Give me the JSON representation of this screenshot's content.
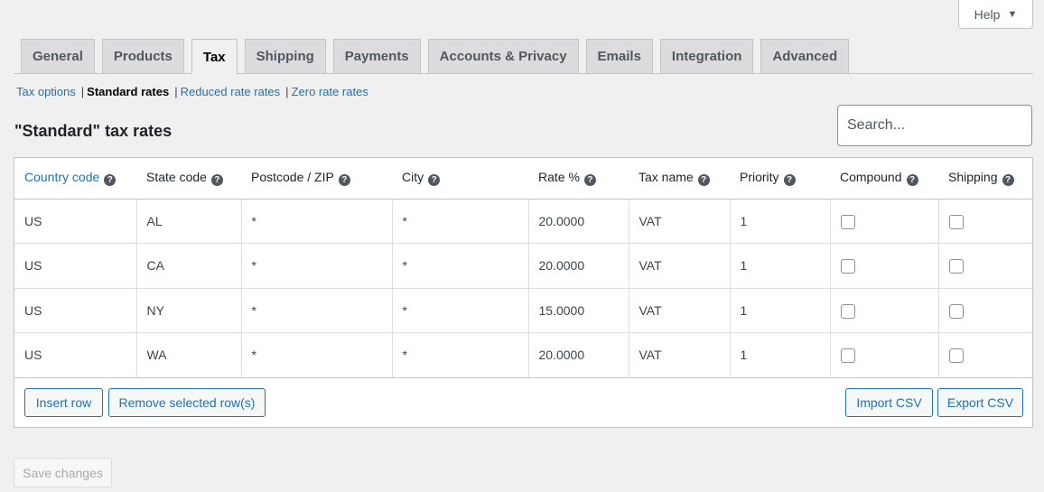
{
  "help": {
    "label": "Help",
    "arrow": "▼"
  },
  "tabs": [
    {
      "label": "General",
      "active": false
    },
    {
      "label": "Products",
      "active": false
    },
    {
      "label": "Tax",
      "active": true
    },
    {
      "label": "Shipping",
      "active": false
    },
    {
      "label": "Payments",
      "active": false
    },
    {
      "label": "Accounts & Privacy",
      "active": false
    },
    {
      "label": "Emails",
      "active": false
    },
    {
      "label": "Integration",
      "active": false
    },
    {
      "label": "Advanced",
      "active": false
    }
  ],
  "subnav": {
    "items": [
      "Tax options",
      "Standard rates",
      "Reduced rate rates",
      "Zero rate rates"
    ],
    "separator": "|"
  },
  "heading": "\"Standard\" tax rates",
  "search": {
    "placeholder": "Search..."
  },
  "table": {
    "help_glyph": "?",
    "columns": [
      "Country code",
      "State code",
      "Postcode / ZIP",
      "City",
      "Rate %",
      "Tax name",
      "Priority",
      "Compound",
      "Shipping"
    ],
    "rows": [
      {
        "country": "US",
        "state": "AL",
        "postcode": "*",
        "city": "*",
        "rate": "20.0000",
        "name": "VAT",
        "priority": "1",
        "compound": false,
        "shipping": false
      },
      {
        "country": "US",
        "state": "CA",
        "postcode": "*",
        "city": "*",
        "rate": "20.0000",
        "name": "VAT",
        "priority": "1",
        "compound": false,
        "shipping": false
      },
      {
        "country": "US",
        "state": "NY",
        "postcode": "*",
        "city": "*",
        "rate": "15.0000",
        "name": "VAT",
        "priority": "1",
        "compound": false,
        "shipping": false
      },
      {
        "country": "US",
        "state": "WA",
        "postcode": "*",
        "city": "*",
        "rate": "20.0000",
        "name": "VAT",
        "priority": "1",
        "compound": false,
        "shipping": false
      }
    ]
  },
  "actions": {
    "insert": "Insert row",
    "remove": "Remove selected row(s)",
    "import": "Import CSV",
    "export": "Export CSV"
  },
  "save": "Save changes",
  "colors": {
    "link": "#2271b1",
    "background": "#f0f0f1",
    "border": "#c3c4c7"
  }
}
